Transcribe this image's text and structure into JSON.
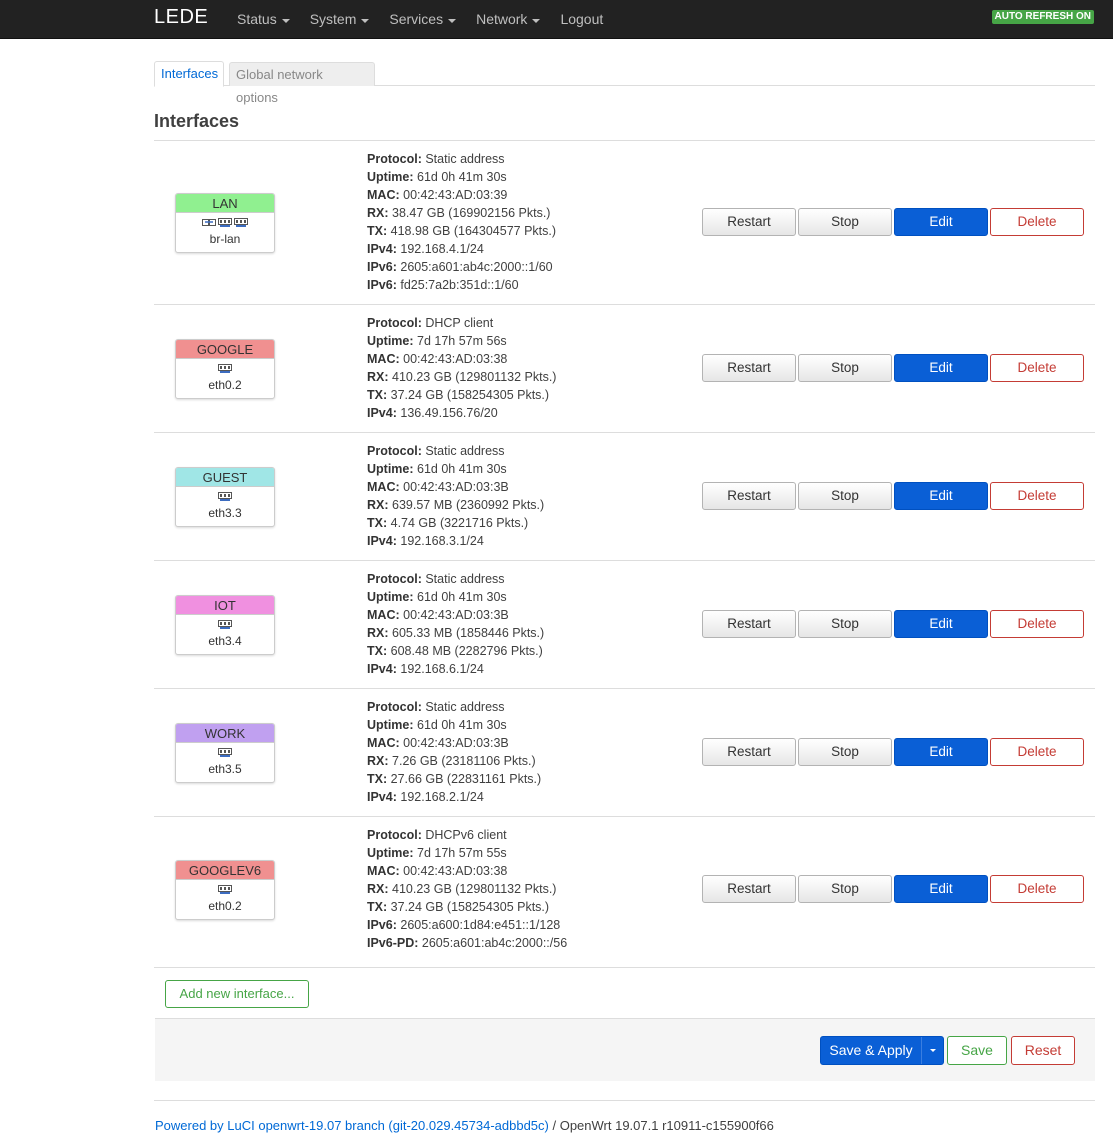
{
  "header": {
    "brand": "LEDE",
    "nav": [
      "Status",
      "System",
      "Services",
      "Network",
      "Logout"
    ],
    "auto_refresh": "AUTO REFRESH ON"
  },
  "tabs": [
    "Interfaces",
    "Global network options"
  ],
  "section_title": "Interfaces",
  "interfaces": [
    {
      "name": "LAN",
      "device": "br-lan",
      "color": "#90f090",
      "icons": [
        "bridge-icon",
        "port-icon",
        "port-icon"
      ],
      "status": [
        [
          "Protocol:",
          "Static address"
        ],
        [
          "Uptime:",
          "61d 0h 41m 30s"
        ],
        [
          "MAC:",
          "00:42:43:AD:03:39"
        ],
        [
          "RX:",
          "38.47 GB (169902156 Pkts.)"
        ],
        [
          "TX:",
          "418.98 GB (164304577 Pkts.)"
        ],
        [
          "IPv4:",
          "192.168.4.1/24"
        ],
        [
          "IPv6:",
          "2605:a601:ab4c:2000::1/60"
        ],
        [
          "IPv6:",
          "fd25:7a2b:351d::1/60"
        ]
      ]
    },
    {
      "name": "GOOGLE",
      "device": "eth0.2",
      "color": "#f09090",
      "icons": [
        "port-icon"
      ],
      "status": [
        [
          "Protocol:",
          "DHCP client"
        ],
        [
          "Uptime:",
          "7d 17h 57m 56s"
        ],
        [
          "MAC:",
          "00:42:43:AD:03:38"
        ],
        [
          "RX:",
          "410.23 GB (129801132 Pkts.)"
        ],
        [
          "TX:",
          "37.24 GB (158254305 Pkts.)"
        ],
        [
          "IPv4:",
          "136.49.156.76/20"
        ]
      ]
    },
    {
      "name": "GUEST",
      "device": "eth3.3",
      "color": "#a0e6e6",
      "icons": [
        "port-icon"
      ],
      "status": [
        [
          "Protocol:",
          "Static address"
        ],
        [
          "Uptime:",
          "61d 0h 41m 30s"
        ],
        [
          "MAC:",
          "00:42:43:AD:03:3B"
        ],
        [
          "RX:",
          "639.57 MB (2360992 Pkts.)"
        ],
        [
          "TX:",
          "4.74 GB (3221716 Pkts.)"
        ],
        [
          "IPv4:",
          "192.168.3.1/24"
        ]
      ]
    },
    {
      "name": "IOT",
      "device": "eth3.4",
      "color": "#f090e0",
      "icons": [
        "port-icon"
      ],
      "status": [
        [
          "Protocol:",
          "Static address"
        ],
        [
          "Uptime:",
          "61d 0h 41m 30s"
        ],
        [
          "MAC:",
          "00:42:43:AD:03:3B"
        ],
        [
          "RX:",
          "605.33 MB (1858446 Pkts.)"
        ],
        [
          "TX:",
          "608.48 MB (2282796 Pkts.)"
        ],
        [
          "IPv4:",
          "192.168.6.1/24"
        ]
      ]
    },
    {
      "name": "WORK",
      "device": "eth3.5",
      "color": "#c0a0f0",
      "icons": [
        "port-icon"
      ],
      "status": [
        [
          "Protocol:",
          "Static address"
        ],
        [
          "Uptime:",
          "61d 0h 41m 30s"
        ],
        [
          "MAC:",
          "00:42:43:AD:03:3B"
        ],
        [
          "RX:",
          "7.26 GB (23181106 Pkts.)"
        ],
        [
          "TX:",
          "27.66 GB (22831161 Pkts.)"
        ],
        [
          "IPv4:",
          "192.168.2.1/24"
        ]
      ]
    },
    {
      "name": "GOOGLEV6",
      "device": "eth0.2",
      "color": "#f09090",
      "icons": [
        "port-icon"
      ],
      "status": [
        [
          "Protocol:",
          "DHCPv6 client"
        ],
        [
          "Uptime:",
          "7d 17h 57m 55s"
        ],
        [
          "MAC:",
          "00:42:43:AD:03:38"
        ],
        [
          "RX:",
          "410.23 GB (129801132 Pkts.)"
        ],
        [
          "TX:",
          "37.24 GB (158254305 Pkts.)"
        ],
        [
          "IPv6:",
          "2605:a600:1d84:e451::1/128"
        ],
        [
          "IPv6-PD:",
          "2605:a601:ab4c:2000::/56"
        ]
      ]
    }
  ],
  "row_buttons": {
    "restart": "Restart",
    "stop": "Stop",
    "edit": "Edit",
    "delete": "Delete"
  },
  "add_interface": "Add new interface...",
  "actions": {
    "save_apply": "Save & Apply",
    "save": "Save",
    "reset": "Reset"
  },
  "footer": {
    "link": "Powered by LuCI openwrt-19.07 branch (git-20.029.45734-adbbd5c)",
    "text": " / OpenWrt 19.07.1 r10911-c155900f66"
  }
}
